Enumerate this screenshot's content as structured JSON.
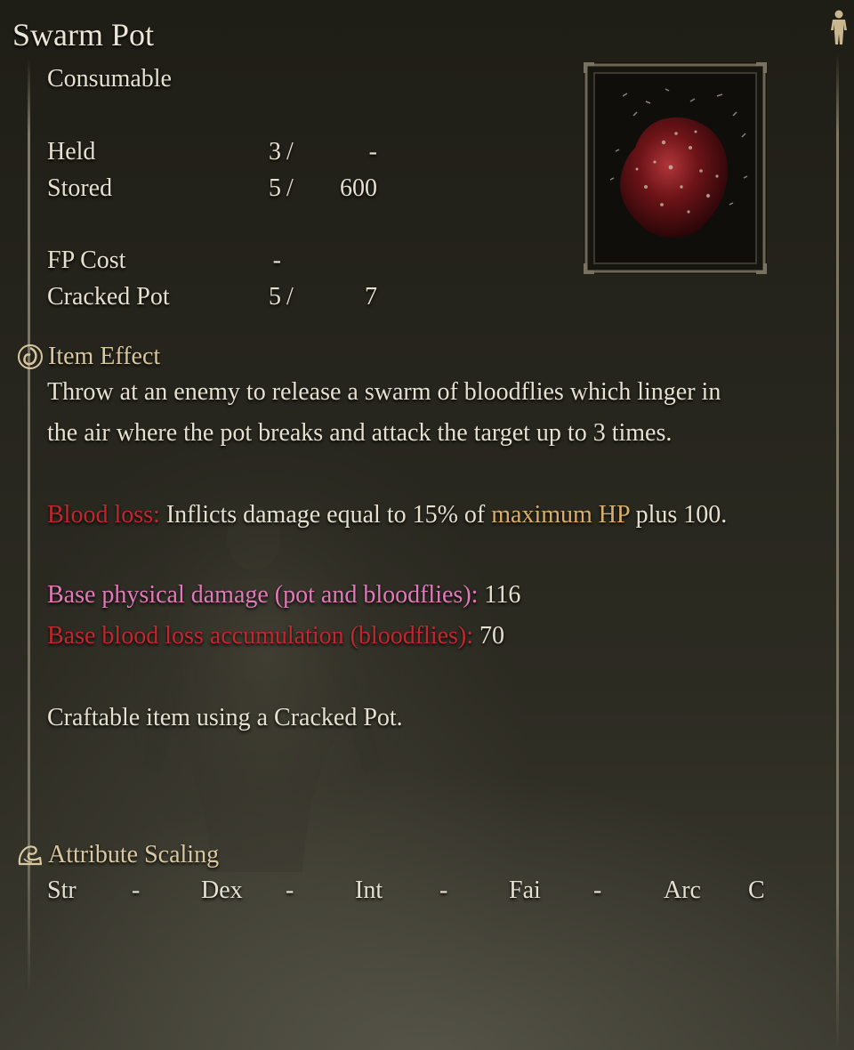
{
  "item": {
    "name": "Swarm Pot",
    "category": "Consumable"
  },
  "stats": {
    "held": {
      "label": "Held",
      "current": "3",
      "sep": "/",
      "max": "-"
    },
    "stored": {
      "label": "Stored",
      "current": "5",
      "sep": "/",
      "max": "600"
    },
    "fp_cost": {
      "label": "FP Cost",
      "value": "-"
    },
    "cracked_pot": {
      "label": "Cracked Pot",
      "current": "5",
      "sep": "/",
      "max": "7"
    }
  },
  "effect": {
    "heading": "Item Effect",
    "description_line1": "Throw at an enemy to release a swarm of bloodflies which linger in",
    "description_line2": "the air where the pot breaks and attack the target up to 3 times.",
    "blood_loss_label": "Blood loss:",
    "blood_loss_text_a": " Inflicts damage equal to 15% of ",
    "blood_loss_highlight": "maximum HP",
    "blood_loss_text_b": " plus 100.",
    "phys_label": "Base physical damage (pot and bloodflies):",
    "phys_value": " 116",
    "bleed_label": "Base blood loss accumulation (bloodflies):",
    "bleed_value": " 70",
    "craft_note": "Craftable item using a Cracked Pot."
  },
  "scaling": {
    "heading": "Attribute Scaling",
    "attributes": [
      {
        "name": "Str",
        "grade": "-"
      },
      {
        "name": "Dex",
        "grade": "-"
      },
      {
        "name": "Int",
        "grade": "-"
      },
      {
        "name": "Fai",
        "grade": "-"
      },
      {
        "name": "Arc",
        "grade": "C"
      }
    ]
  },
  "colors": {
    "blood_loss": "#c0282e",
    "highlight": "#dcae6c",
    "physical": "#e07ab8",
    "heading": "#d9c79f",
    "text": "#e6e0d0"
  },
  "icons": {
    "top_right": "character-figure-icon",
    "effect": "item-effect-swirl-icon",
    "scaling": "attribute-scaling-arm-icon",
    "item_image": "swarm-pot-image"
  }
}
